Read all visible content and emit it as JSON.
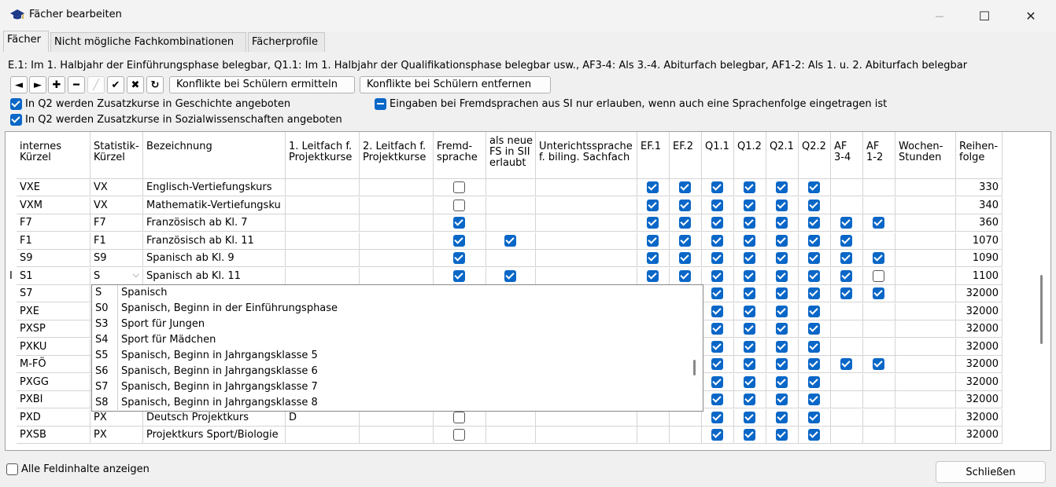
{
  "window": {
    "title": "Fächer bearbeiten",
    "minimize_glyph": "—",
    "maximize_glyph": "☐",
    "close_glyph": "✕"
  },
  "tabs": [
    {
      "label": "Fächer",
      "active": true
    },
    {
      "label": "Nicht mögliche Fachkombinationen",
      "active": false
    },
    {
      "label": "Fächerprofile",
      "active": false
    }
  ],
  "info_text": "E.1: Im 1. Halbjahr der Einführungsphase belegbar, Q1.1: Im 1. Halbjahr der Qualifikationsphase belegbar usw., AF3-4: Als 3.-4. Abiturfach belegbar, AF1-2: Als 1. u. 2. Abiturfach belegbar",
  "toolbar": {
    "icons": [
      {
        "name": "prev-icon",
        "glyph": "◄",
        "disabled": false
      },
      {
        "name": "next-icon",
        "glyph": "►",
        "disabled": false
      },
      {
        "name": "add-icon",
        "glyph": "✚",
        "disabled": false
      },
      {
        "name": "remove-icon",
        "glyph": "━",
        "disabled": false
      },
      {
        "name": "edit-icon",
        "glyph": "╱",
        "disabled": true
      },
      {
        "name": "confirm-icon",
        "glyph": "✔",
        "disabled": false
      },
      {
        "name": "cancel-icon",
        "glyph": "✖",
        "disabled": false
      },
      {
        "name": "refresh-icon",
        "glyph": "↻",
        "disabled": false
      }
    ],
    "conflicts_find_label": "Konflikte bei Schülern ermitteln",
    "conflicts_remove_label": "Konflikte bei Schülern entfernen"
  },
  "options": {
    "q2_geschichte": {
      "label": "In Q2 werden Zusatzkurse in Geschichte angeboten",
      "checked": true
    },
    "q2_sowi": {
      "label": "In Q2 werden Zusatzkurse in Sozialwissenschaften angeboten",
      "checked": true
    },
    "fremdsprachen": {
      "label": "Eingaben bei Fremdsprachen aus SI nur erlauben, wenn auch eine Sprachenfolge eingetragen ist",
      "state": "indeterminate"
    }
  },
  "table": {
    "headers": [
      "internes\nKürzel",
      "Statistik-\nKürzel",
      "Bezeichnung",
      "1. Leitfach f.\nProjektkurse",
      "2. Leitfach f.\nProjektkurse",
      "Fremd-\nsprache",
      "als neue\nFS in SII\nerlaubt",
      "Unterichtssprache\nf. biling. Sachfach",
      "EF.1",
      "EF.2",
      "Q1.1",
      "Q1.2",
      "Q2.1",
      "Q2.2",
      "AF\n3-4",
      "AF\n1-2",
      "Wochen-\nStunden",
      "Reihen-\nfolge"
    ],
    "rows": [
      {
        "k": "VXE",
        "s": "VX",
        "b": "Englisch-Vertiefungskurs",
        "l1": "",
        "l2": "",
        "fs": "off",
        "nfs": null,
        "ef1": true,
        "ef2": true,
        "q11": true,
        "q12": true,
        "q21": true,
        "q22": true,
        "af34": null,
        "af12": null,
        "ws": "",
        "rf": "330"
      },
      {
        "k": "VXM",
        "s": "VX",
        "b": "Mathematik-Vertiefungsku",
        "l1": "",
        "l2": "",
        "fs": "off",
        "nfs": null,
        "ef1": true,
        "ef2": true,
        "q11": true,
        "q12": true,
        "q21": true,
        "q22": true,
        "af34": null,
        "af12": null,
        "ws": "",
        "rf": "340"
      },
      {
        "k": "F7",
        "s": "F7",
        "b": "Französisch ab Kl. 7",
        "l1": "",
        "l2": "",
        "fs": "on",
        "nfs": null,
        "ef1": true,
        "ef2": true,
        "q11": true,
        "q12": true,
        "q21": true,
        "q22": true,
        "af34": "on",
        "af12": "on",
        "ws": "",
        "rf": "360"
      },
      {
        "k": "F1",
        "s": "F1",
        "b": "Französisch ab Kl. 11",
        "l1": "",
        "l2": "",
        "fs": "on",
        "nfs": "on",
        "ef1": true,
        "ef2": true,
        "q11": true,
        "q12": true,
        "q21": true,
        "q22": true,
        "af34": "on",
        "af12": null,
        "ws": "",
        "rf": "1070"
      },
      {
        "k": "S9",
        "s": "S9",
        "b": "Spanisch ab Kl. 9",
        "l1": "",
        "l2": "",
        "fs": "on",
        "nfs": null,
        "ef1": true,
        "ef2": true,
        "q11": true,
        "q12": true,
        "q21": true,
        "q22": true,
        "af34": "on",
        "af12": "on",
        "ws": "",
        "rf": "1090"
      },
      {
        "k": "S1",
        "s": "S",
        "b": "Spanisch ab Kl. 11",
        "l1": "",
        "l2": "",
        "fs": "on",
        "nfs": "on",
        "ef1": true,
        "ef2": true,
        "q11": true,
        "q12": true,
        "q21": true,
        "q22": true,
        "af34": "on",
        "af12": "off",
        "ws": "",
        "rf": "1100"
      },
      {
        "k": "S7",
        "s": "",
        "b": "",
        "l1": "",
        "l2": "",
        "fs": null,
        "nfs": null,
        "ef1": false,
        "ef2": false,
        "q11": true,
        "q12": true,
        "q21": true,
        "q22": true,
        "af34": "on",
        "af12": "on",
        "ws": "",
        "rf": "32000"
      },
      {
        "k": "PXE",
        "s": "",
        "b": "",
        "l1": "",
        "l2": "",
        "fs": null,
        "nfs": null,
        "ef1": false,
        "ef2": false,
        "q11": true,
        "q12": true,
        "q21": true,
        "q22": true,
        "af34": null,
        "af12": null,
        "ws": "",
        "rf": "32000"
      },
      {
        "k": "PXSP",
        "s": "",
        "b": "",
        "l1": "",
        "l2": "",
        "fs": null,
        "nfs": null,
        "ef1": false,
        "ef2": false,
        "q11": true,
        "q12": true,
        "q21": true,
        "q22": true,
        "af34": null,
        "af12": null,
        "ws": "",
        "rf": "32000"
      },
      {
        "k": "PXKU",
        "s": "",
        "b": "",
        "l1": "",
        "l2": "",
        "fs": null,
        "nfs": null,
        "ef1": false,
        "ef2": false,
        "q11": true,
        "q12": true,
        "q21": true,
        "q22": true,
        "af34": null,
        "af12": null,
        "ws": "",
        "rf": "32000"
      },
      {
        "k": "M-FÖ",
        "s": "",
        "b": "",
        "l1": "",
        "l2": "",
        "fs": null,
        "nfs": null,
        "ef1": false,
        "ef2": false,
        "q11": true,
        "q12": true,
        "q21": true,
        "q22": true,
        "af34": "on",
        "af12": "on",
        "ws": "",
        "rf": "32000"
      },
      {
        "k": "PXGG",
        "s": "",
        "b": "",
        "l1": "",
        "l2": "",
        "fs": null,
        "nfs": null,
        "ef1": false,
        "ef2": false,
        "q11": true,
        "q12": true,
        "q21": true,
        "q22": true,
        "af34": null,
        "af12": null,
        "ws": "",
        "rf": "32000"
      },
      {
        "k": "PXBI",
        "s": "",
        "b": "",
        "l1": "",
        "l2": "",
        "fs": null,
        "nfs": null,
        "ef1": false,
        "ef2": false,
        "q11": true,
        "q12": true,
        "q21": true,
        "q22": true,
        "af34": null,
        "af12": null,
        "ws": "",
        "rf": "32000"
      },
      {
        "k": "PXD",
        "s": "PX",
        "b": "Deutsch Projektkurs",
        "l1": "D",
        "l2": "",
        "fs": "off",
        "nfs": null,
        "ef1": false,
        "ef2": false,
        "q11": true,
        "q12": true,
        "q21": true,
        "q22": true,
        "af34": null,
        "af12": null,
        "ws": "",
        "rf": "32000"
      },
      {
        "k": "PXSB",
        "s": "PX",
        "b": "Projektkurs Sport/Biologie",
        "l1": "",
        "l2": "",
        "fs": "off",
        "nfs": null,
        "ef1": false,
        "ef2": false,
        "q11": true,
        "q12": true,
        "q21": true,
        "q22": true,
        "af34": null,
        "af12": null,
        "ws": "",
        "rf": "32000"
      }
    ],
    "row_marker": "I",
    "dropdown_arrow": "⌵"
  },
  "dropdown": [
    {
      "code": "S",
      "name": "Spanisch"
    },
    {
      "code": "S0",
      "name": "Spanisch, Beginn in der Einführungsphase"
    },
    {
      "code": "S3",
      "name": "Sport für Jungen"
    },
    {
      "code": "S4",
      "name": "Sport für Mädchen"
    },
    {
      "code": "S5",
      "name": "Spanisch, Beginn in Jahrgangsklasse 5"
    },
    {
      "code": "S6",
      "name": "Spanisch, Beginn in Jahrgangsklasse 6"
    },
    {
      "code": "S7",
      "name": "Spanisch, Beginn in Jahrgangsklasse 7"
    },
    {
      "code": "S8",
      "name": "Spanisch, Beginn in Jahrgangsklasse 8"
    }
  ],
  "footer": {
    "show_all_label": "Alle Feldinhalte anzeigen",
    "show_all_checked": false,
    "close_label": "Schließen"
  },
  "colors": {
    "accent": "#0a67c7"
  }
}
